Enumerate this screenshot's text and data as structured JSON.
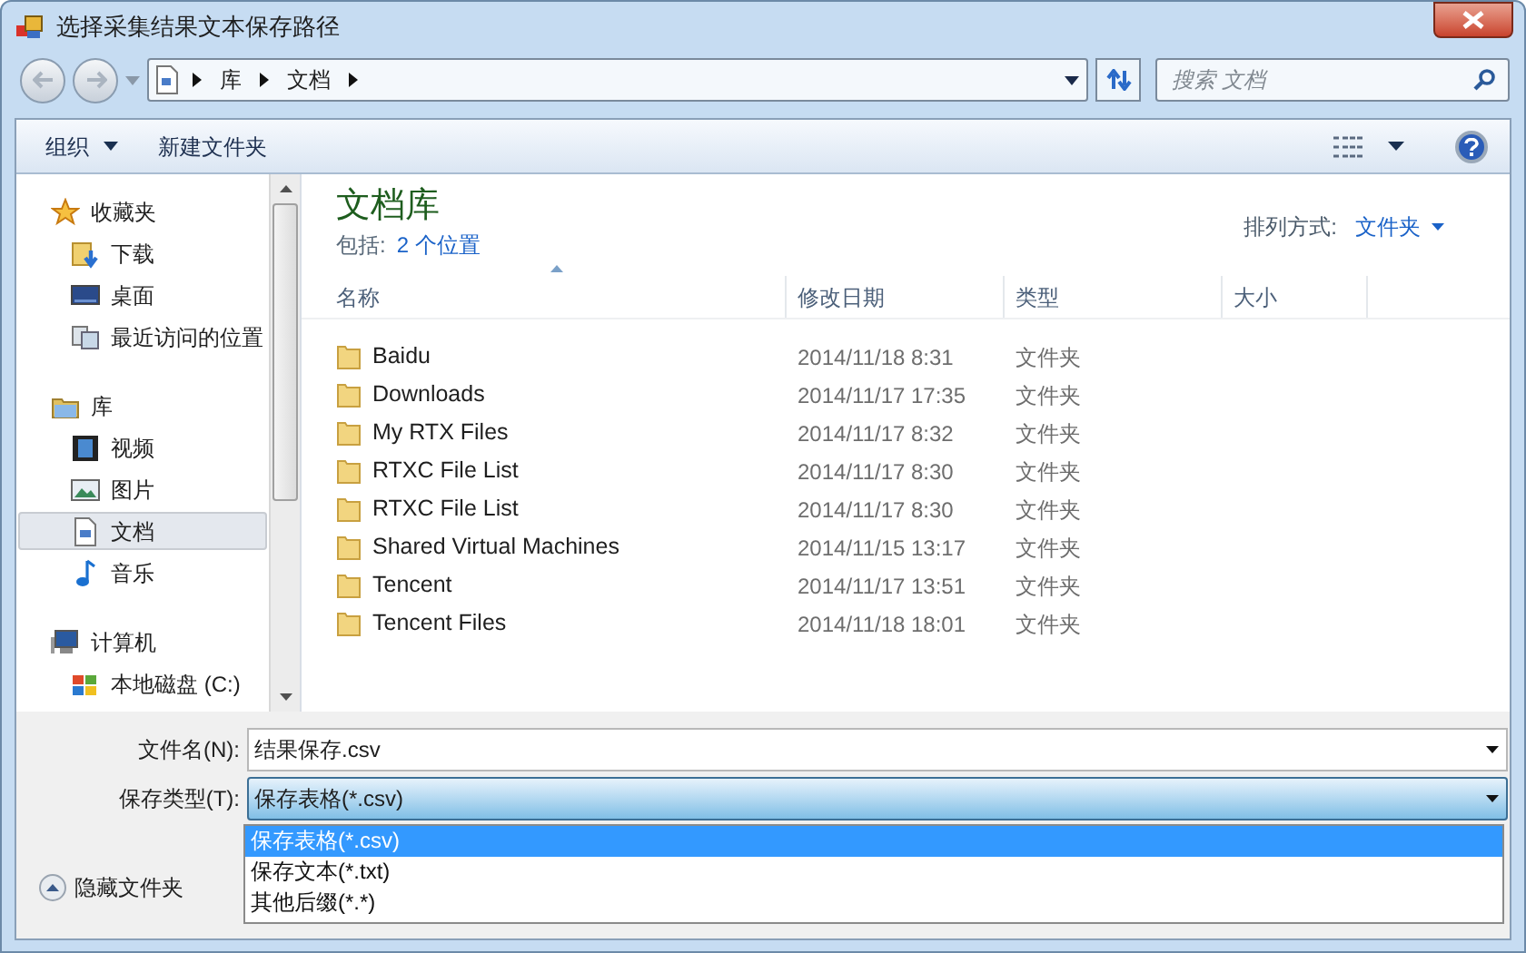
{
  "window": {
    "title": "选择采集结果文本保存路径"
  },
  "address_bar": {
    "crumbs": [
      "库",
      "文档"
    ]
  },
  "search": {
    "placeholder": "搜索 文档"
  },
  "toolbar": {
    "buttons": [
      {
        "label": "组织",
        "dropdown": true
      },
      {
        "label": "新建文件夹",
        "dropdown": false
      }
    ]
  },
  "sidebar": {
    "groups": [
      {
        "label": "收藏夹",
        "kind": "star",
        "children": [
          {
            "label": "下载",
            "kind": "download",
            "selected": false
          },
          {
            "label": "桌面",
            "kind": "desktop",
            "selected": false
          },
          {
            "label": "最近访问的位置",
            "kind": "recent",
            "selected": false
          }
        ]
      },
      {
        "label": "库",
        "kind": "library",
        "children": [
          {
            "label": "视频",
            "kind": "video",
            "selected": false
          },
          {
            "label": "图片",
            "kind": "picture",
            "selected": false
          },
          {
            "label": "文档",
            "kind": "document",
            "selected": true
          },
          {
            "label": "音乐",
            "kind": "music",
            "selected": false
          }
        ]
      },
      {
        "label": "计算机",
        "kind": "computer",
        "children": [
          {
            "label": "本地磁盘 (C:)",
            "kind": "drive",
            "selected": false
          }
        ]
      }
    ]
  },
  "library": {
    "title": "文档库",
    "includes_label": "包括:",
    "includes_link": "2 个位置",
    "arrange_label": "排列方式:",
    "arrange_value": "文件夹"
  },
  "table": {
    "columns": [
      {
        "label": "名称",
        "sorted": true
      },
      {
        "label": "修改日期",
        "sorted": false
      },
      {
        "label": "类型",
        "sorted": false
      },
      {
        "label": "大小",
        "sorted": false
      }
    ],
    "rows": [
      {
        "name": "Baidu",
        "modified": "2014/11/18 8:31",
        "type": "文件夹"
      },
      {
        "name": "Downloads",
        "modified": "2014/11/17 17:35",
        "type": "文件夹"
      },
      {
        "name": "My RTX Files",
        "modified": "2014/11/17 8:32",
        "type": "文件夹"
      },
      {
        "name": "RTXC File List",
        "modified": "2014/11/17 8:30",
        "type": "文件夹"
      },
      {
        "name": "RTXC File List",
        "modified": "2014/11/17 8:30",
        "type": "文件夹"
      },
      {
        "name": "Shared Virtual Machines",
        "modified": "2014/11/15 13:17",
        "type": "文件夹"
      },
      {
        "name": "Tencent",
        "modified": "2014/11/17 13:51",
        "type": "文件夹"
      },
      {
        "name": "Tencent Files",
        "modified": "2014/11/18 18:01",
        "type": "文件夹"
      }
    ]
  },
  "form": {
    "filename_label": "文件名(N):",
    "filename_value": "结果保存.csv",
    "filetype_label": "保存类型(T):",
    "filetype_value": "保存表格(*.csv)",
    "options": [
      {
        "label": "保存表格(*.csv)",
        "selected": true
      },
      {
        "label": "保存文本(*.txt)",
        "selected": false
      },
      {
        "label": "其他后缀(*.*)",
        "selected": false
      }
    ]
  },
  "hide_folders": {
    "label": "隐藏文件夹"
  }
}
